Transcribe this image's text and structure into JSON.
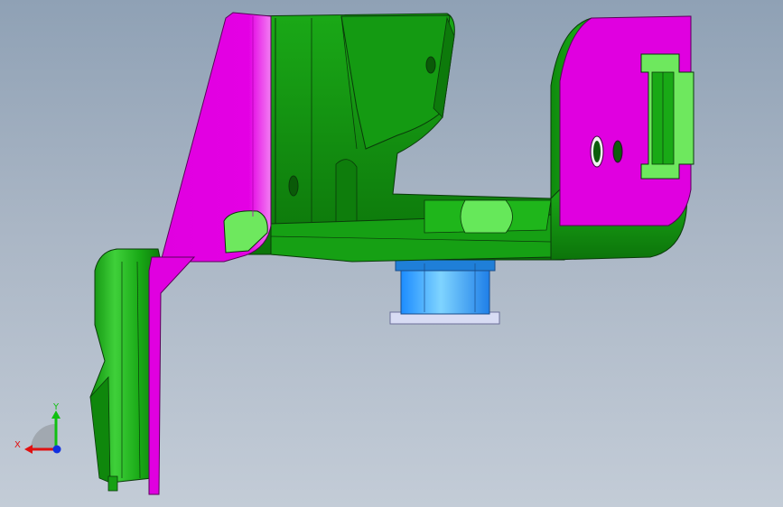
{
  "viewport": {
    "background_top": "#8fa1b5",
    "background_bottom": "#c3ccd7"
  },
  "model": {
    "colors": {
      "green_face": "#16a214",
      "green_light": "#6ee85e",
      "green_dark": "#0c6e0a",
      "magenta_face": "#e000e0",
      "magenta_light": "#f070f0",
      "blue_part": "#2aa8ff",
      "edge": "#0a3a0a"
    }
  },
  "triad": {
    "x_label": "X",
    "y_label": "Y",
    "x_color": "#e01010",
    "y_color": "#10c010",
    "z_color": "#1030e0"
  }
}
